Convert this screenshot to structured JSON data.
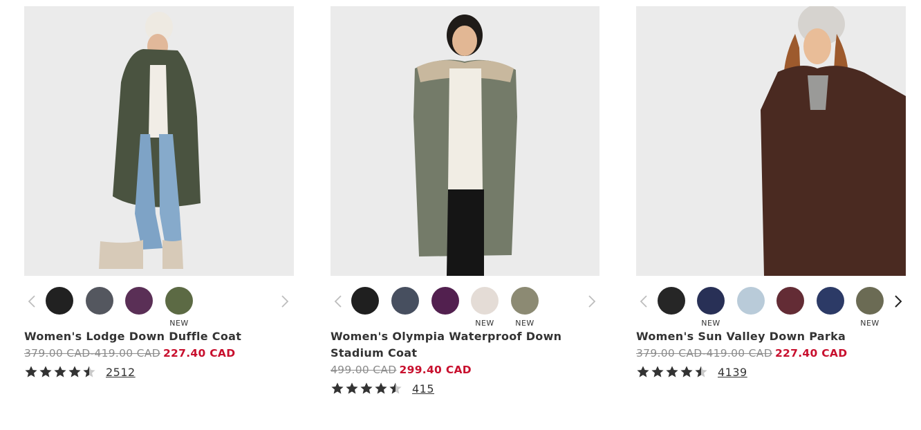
{
  "products": [
    {
      "name": "Women's Lodge Down Duffle Coat",
      "original_price": "379.00 CAD-419.00 CAD",
      "sale_price": "227.40 CAD",
      "rating": 4.5,
      "review_count": "2512",
      "coat_color": "#4a5340",
      "swatches": [
        {
          "color": "#212121",
          "label": ""
        },
        {
          "color": "#54575f",
          "label": ""
        },
        {
          "color": "#5a2f56",
          "label": ""
        },
        {
          "color": "#5c6a44",
          "label": "NEW"
        }
      ]
    },
    {
      "name": "Women's Olympia Waterproof Down Stadium Coat",
      "original_price": "499.00 CAD",
      "sale_price": "299.40 CAD",
      "rating": 4.5,
      "review_count": "415",
      "coat_color": "#747b69",
      "swatches": [
        {
          "color": "#1f1f1f",
          "label": ""
        },
        {
          "color": "#474f5f",
          "label": ""
        },
        {
          "color": "#52204f",
          "label": ""
        },
        {
          "color": "#e4dcd6",
          "label": "NEW"
        },
        {
          "color": "#8c8a73",
          "label": "NEW"
        }
      ]
    },
    {
      "name": "Women's Sun Valley Down Parka",
      "original_price": "379.00 CAD-419.00 CAD",
      "sale_price": "227.40 CAD",
      "rating": 4.5,
      "review_count": "4139",
      "coat_color": "#4a2a21",
      "swatches": [
        {
          "color": "#262626",
          "label": ""
        },
        {
          "color": "#283056",
          "label": "NEW"
        },
        {
          "color": "#b9cbd9",
          "label": ""
        },
        {
          "color": "#632c35",
          "label": ""
        },
        {
          "color": "#2c3a66",
          "label": ""
        },
        {
          "color": "#6b6b54",
          "label": "NEW"
        }
      ]
    }
  ]
}
